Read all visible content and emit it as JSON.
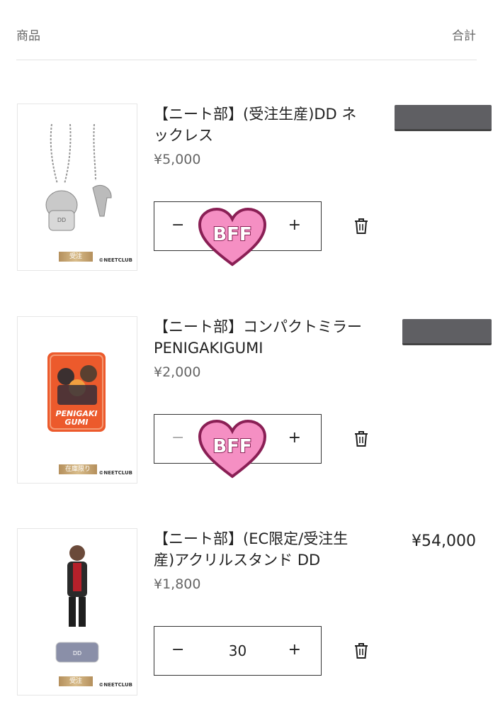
{
  "header": {
    "product_label": "商品",
    "total_label": "合計"
  },
  "sticker_text": "BFF",
  "items": [
    {
      "title": "【ニート部】(受注生産)DD ネックレス",
      "price": "¥5,000",
      "quantity": "",
      "minus": "−",
      "plus": "+",
      "badge": "受注",
      "logo": "©NEETCLUB",
      "pendant_text": "DD",
      "total": ""
    },
    {
      "title": "【ニート部】コンパクトミラー PENIGAKIGUMI",
      "price": "¥2,000",
      "quantity": "",
      "minus": "−",
      "plus": "+",
      "badge": "在庫限り",
      "logo": "©NEETCLUB",
      "mirror_text_1": "PENIGAKI",
      "mirror_text_2": "GUMI",
      "total": ""
    },
    {
      "title": "【ニート部】(EC限定/受注生産)アクリルスタンド DD",
      "price": "¥1,800",
      "quantity": "30",
      "minus": "−",
      "plus": "+",
      "badge": "受注",
      "logo": "©NEETCLUB",
      "stand_text": "DD",
      "total": "¥54,000"
    }
  ],
  "colors": {
    "sticker_fill": "#f58fc3",
    "sticker_stroke": "#8a1f55",
    "redaction": "#5f5f63",
    "mirror": "#ec5a2c"
  }
}
